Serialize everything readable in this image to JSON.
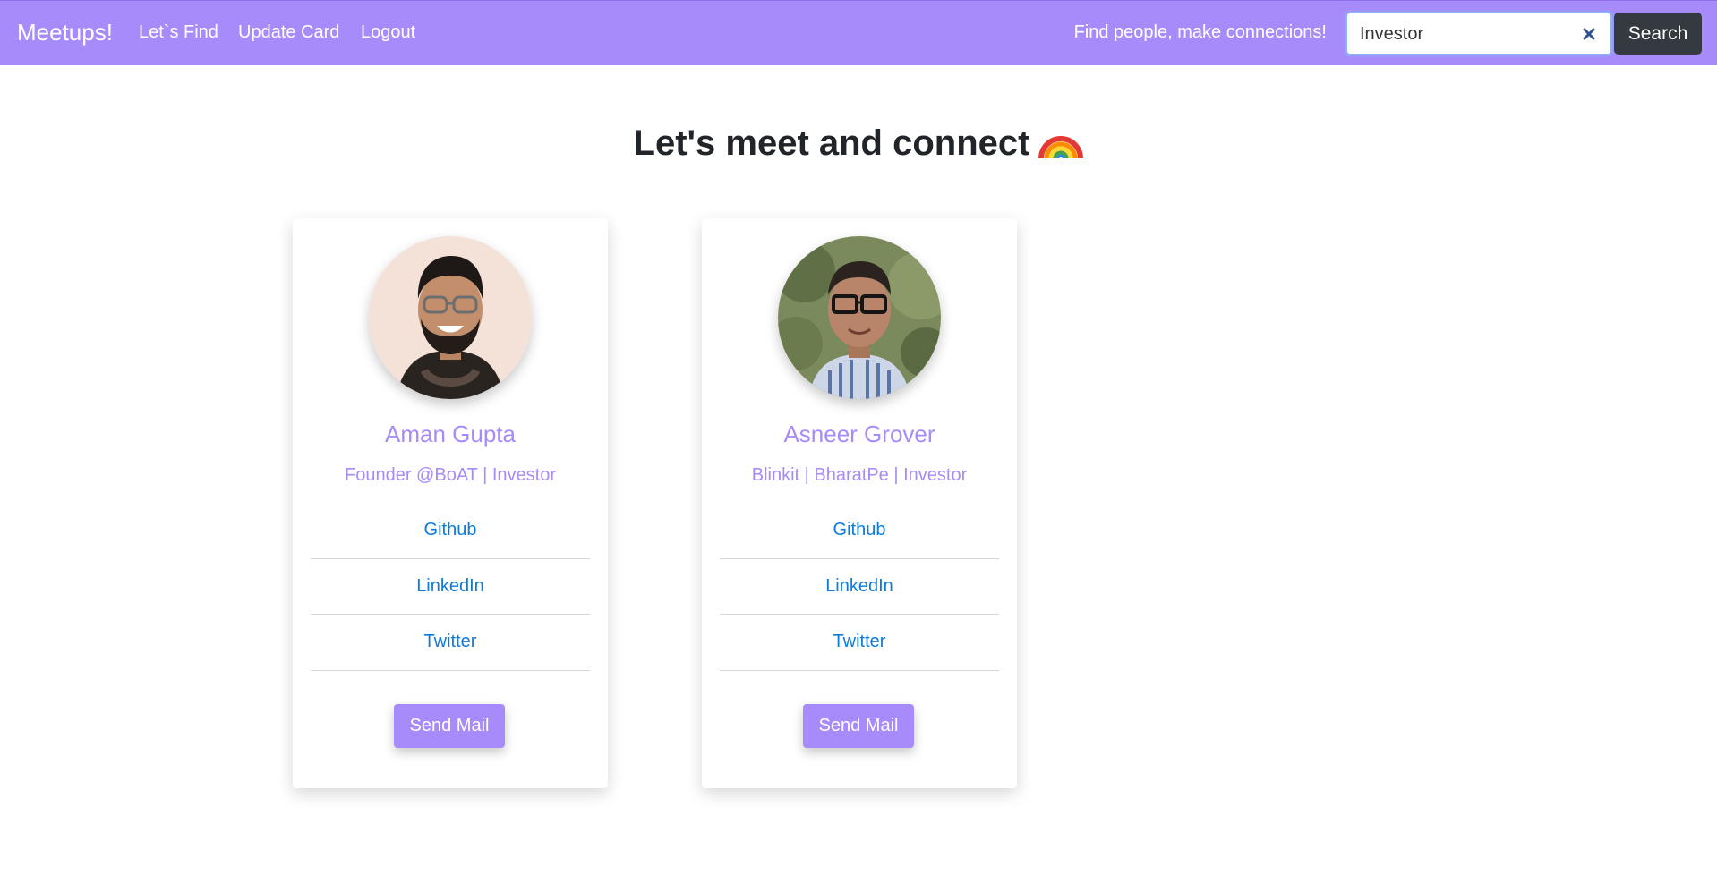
{
  "navbar": {
    "brand": "Meetups!",
    "links": [
      "Let`s Find",
      "Update Card",
      "Logout"
    ],
    "tagline": "Find people, make connections!",
    "search": {
      "value": "Investor",
      "button_label": "Search"
    }
  },
  "main": {
    "heading": "Let's meet and connect"
  },
  "cards": [
    {
      "name": "Aman Gupta",
      "role": "Founder @BoAT | Investor",
      "links": [
        "Github",
        "LinkedIn",
        "Twitter"
      ],
      "button_label": "Send Mail"
    },
    {
      "name": "Asneer Grover",
      "role": "Blinkit | BharatPe | Investor",
      "links": [
        "Github",
        "LinkedIn",
        "Twitter"
      ],
      "button_label": "Send Mail"
    }
  ],
  "colors": {
    "navbar": "#a78bfa",
    "accent": "#a78bfa",
    "link": "#0d7bdc",
    "search_button": "#343a40"
  },
  "icons": [
    "close-icon",
    "rainbow-icon"
  ]
}
